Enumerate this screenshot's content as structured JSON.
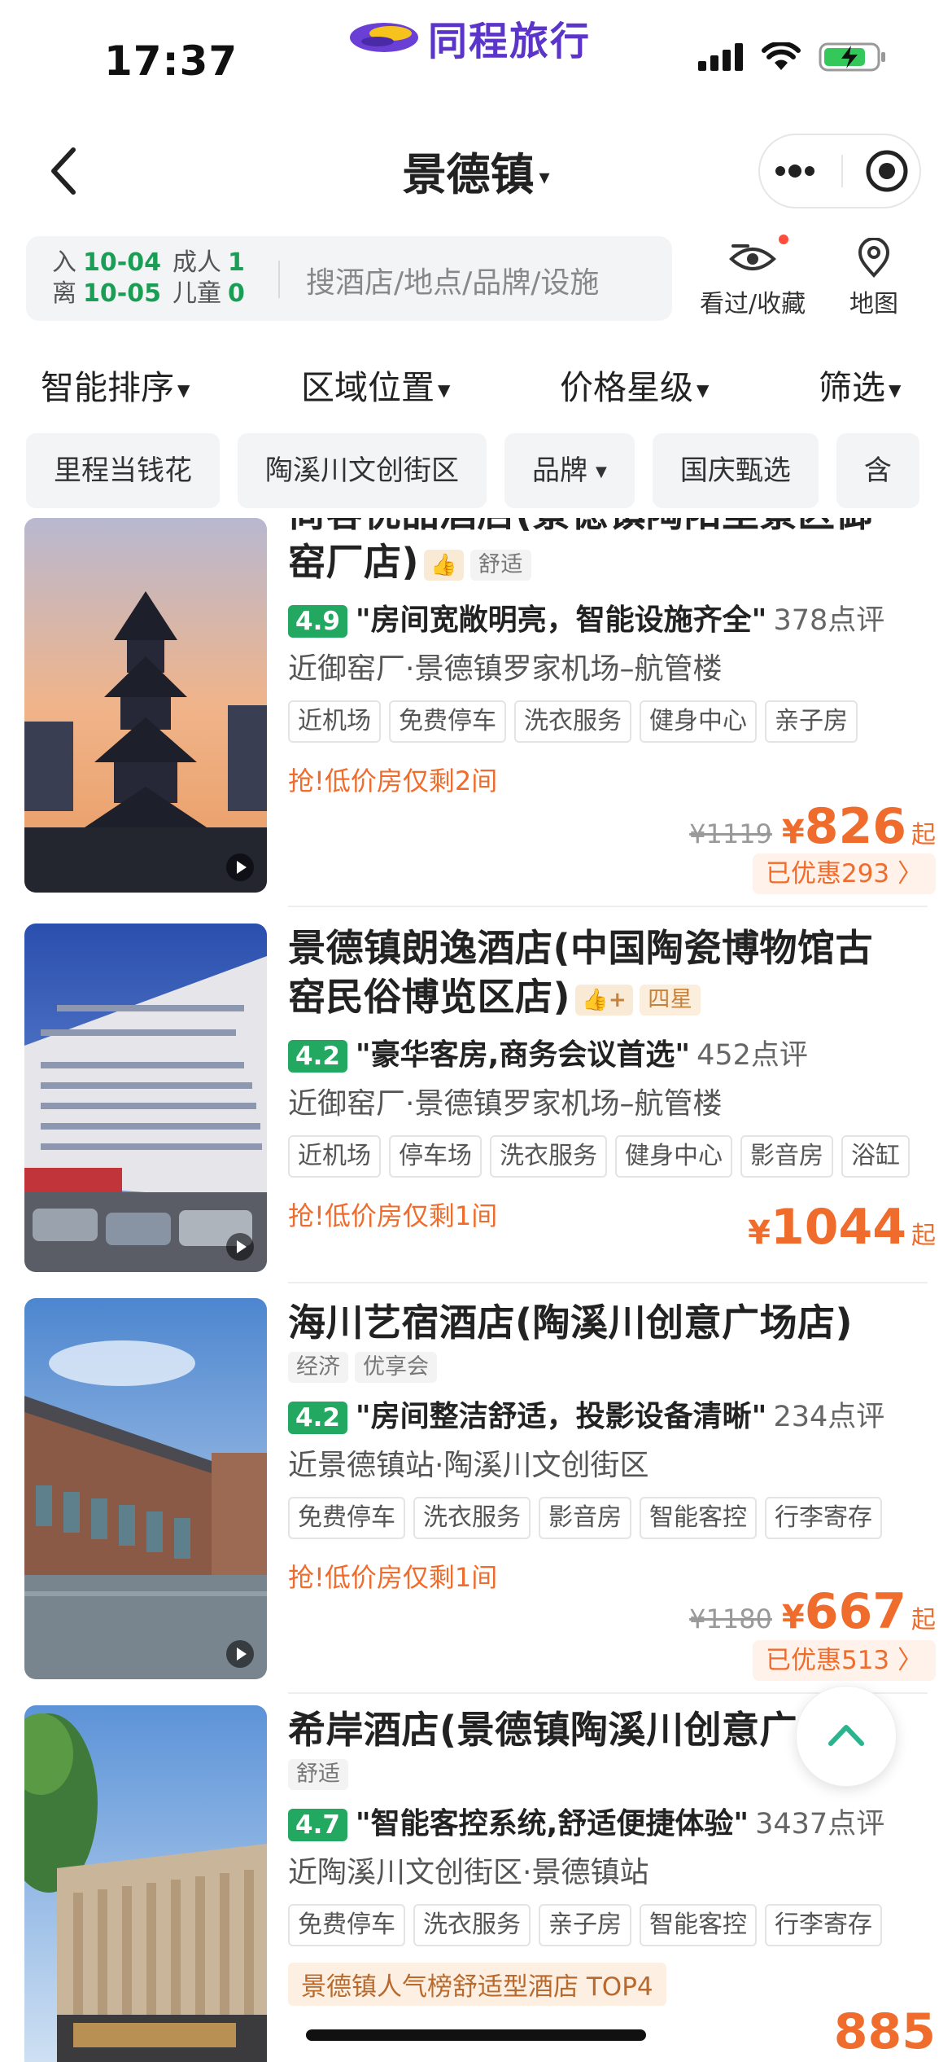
{
  "status_bar": {
    "time": "17:37",
    "brand": "同程旅行"
  },
  "nav": {
    "city": "景德镇",
    "caret": "▾"
  },
  "search": {
    "checkin_label": "入",
    "checkin_date": "10-04",
    "checkout_label": "离",
    "checkout_date": "10-05",
    "adults_label": "成人",
    "adults": "1",
    "children_label": "儿童",
    "children": "0",
    "placeholder": "搜酒店/地点/品牌/设施"
  },
  "tools": {
    "history_label": "看过/收藏",
    "map_label": "地图"
  },
  "sort": [
    "智能排序",
    "区域位置",
    "价格星级",
    "筛选"
  ],
  "chips": [
    "里程当钱花",
    "陶溪川文创街区",
    "品牌",
    "国庆甄选",
    "含"
  ],
  "hotels": [
    {
      "name_line1": "尚客优品酒店(景德镇陶阳里景区御",
      "name_line2": "窑厂店)",
      "badge": "👍",
      "tag": "舒适",
      "score": "4.9",
      "quote": "\"房间宽敞明亮，智能设施齐全\"",
      "reviews": "378点评",
      "location": "近御窑厂·景德镇罗家机场–航管楼",
      "amenities": [
        "近机场",
        "免费停车",
        "洗衣服务",
        "健身中心",
        "亲子房"
      ],
      "promo": "抢!低价房仅剩2间",
      "old_price": "¥1119",
      "yen": "¥",
      "price": "826",
      "suffix": "起",
      "saved": "已优惠293 〉"
    },
    {
      "name_line1": "景德镇朗逸酒店(中国陶瓷博物馆古",
      "name_line2": "窑民俗博览区店)",
      "badge": "👍+",
      "tag": "四星",
      "score": "4.2",
      "quote": "\"豪华客房,商务会议首选\"",
      "reviews": "452点评",
      "location": "近御窑厂·景德镇罗家机场–航管楼",
      "amenities": [
        "近机场",
        "停车场",
        "洗衣服务",
        "健身中心",
        "影音房",
        "浴缸"
      ],
      "promo": "抢!低价房仅剩1间",
      "yen": "¥",
      "price": "1044",
      "suffix": "起"
    },
    {
      "name_line1": "海川艺宿酒店(陶溪川创意广场店)",
      "tags": [
        "经济",
        "优享会"
      ],
      "score": "4.2",
      "quote": "\"房间整洁舒适，投影设备清晰\"",
      "reviews": "234点评",
      "location": "近景德镇站·陶溪川文创街区",
      "amenities": [
        "免费停车",
        "洗衣服务",
        "影音房",
        "智能客控",
        "行李寄存"
      ],
      "promo": "抢!低价房仅剩1间",
      "old_price": "¥1180",
      "yen": "¥",
      "price": "667",
      "suffix": "起",
      "saved": "已优惠513 〉"
    },
    {
      "name_line1": "希岸酒店(景德镇陶溪川创意广场店)",
      "tag": "舒适",
      "score": "4.7",
      "quote": "\"智能客控系统,舒适便捷体验\"",
      "reviews": "3437点评",
      "location": "近陶溪川文创街区·景德镇站",
      "amenities": [
        "免费停车",
        "洗衣服务",
        "亲子房",
        "智能客控",
        "行李寄存"
      ],
      "rank": "景德镇人气榜舒适型酒店 TOP4",
      "price": "885"
    }
  ],
  "colors": {
    "accent": "#ef6c2c",
    "score_green": "#22a860",
    "brand_purple": "#5b35c9",
    "date_green": "#1a9e55"
  },
  "icons": [
    "back-icon",
    "more-icon",
    "target-icon",
    "eye-icon",
    "map-pin-icon",
    "play-icon",
    "chevron-up-icon",
    "thumbs-up-icon"
  ]
}
